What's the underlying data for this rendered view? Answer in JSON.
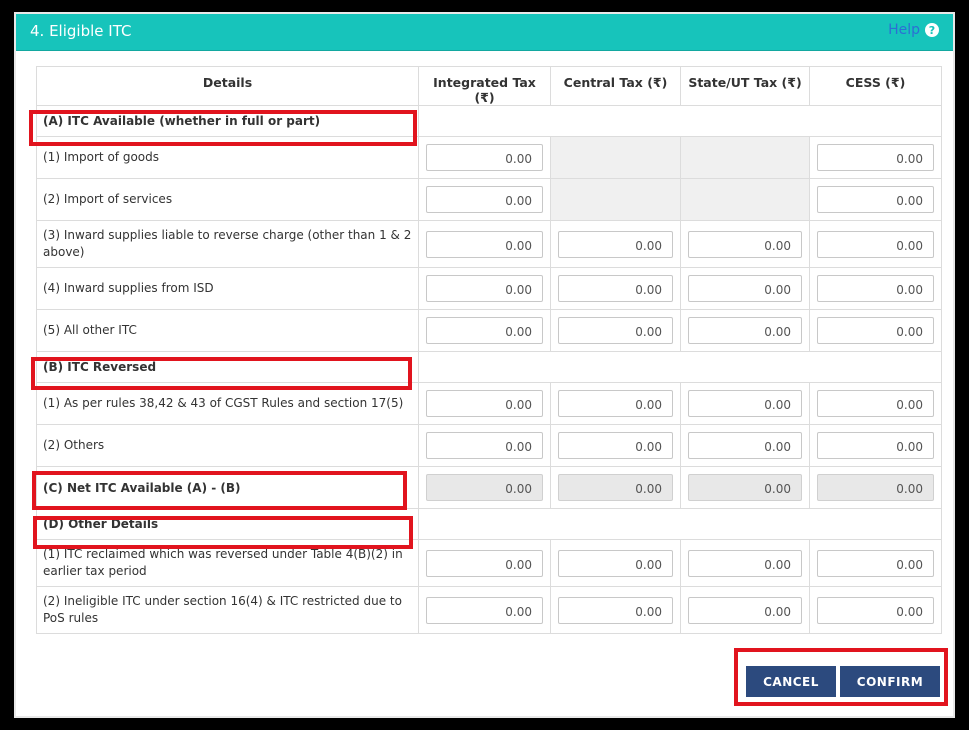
{
  "header": {
    "title": "4. Eligible ITC",
    "help_label": "Help"
  },
  "columns": [
    "Details",
    "Integrated Tax (₹)",
    "Central Tax (₹)",
    "State/UT Tax (₹)",
    "CESS (₹)"
  ],
  "sections": {
    "A": "(A) ITC Available (whether in full or part)",
    "B": "(B) ITC Reversed",
    "C": "(C) Net ITC Available (A) - (B)",
    "D": "(D) Other Details"
  },
  "rows": {
    "a1": {
      "label": "(1) Import of goods",
      "igst": "0.00",
      "cess": "0.00"
    },
    "a2": {
      "label": "(2) Import of services",
      "igst": "0.00",
      "cess": "0.00"
    },
    "a3": {
      "label": "(3) Inward supplies liable to reverse charge (other than 1 & 2 above)",
      "igst": "0.00",
      "cgst": "0.00",
      "sgst": "0.00",
      "cess": "0.00"
    },
    "a4": {
      "label": "(4) Inward supplies from ISD",
      "igst": "0.00",
      "cgst": "0.00",
      "sgst": "0.00",
      "cess": "0.00"
    },
    "a5": {
      "label": "(5) All other ITC",
      "igst": "0.00",
      "cgst": "0.00",
      "sgst": "0.00",
      "cess": "0.00"
    },
    "b1": {
      "label": "(1) As per rules 38,42 & 43 of CGST Rules and section 17(5)",
      "igst": "0.00",
      "cgst": "0.00",
      "sgst": "0.00",
      "cess": "0.00"
    },
    "b2": {
      "label": "(2) Others",
      "igst": "0.00",
      "cgst": "0.00",
      "sgst": "0.00",
      "cess": "0.00"
    },
    "c": {
      "igst": "0.00",
      "cgst": "0.00",
      "sgst": "0.00",
      "cess": "0.00"
    },
    "d1": {
      "label": "(1) ITC reclaimed which was reversed under Table 4(B)(2) in earlier tax period",
      "igst": "0.00",
      "cgst": "0.00",
      "sgst": "0.00",
      "cess": "0.00"
    },
    "d2": {
      "label": "(2) Ineligible ITC under section 16(4) & ITC restricted due to PoS rules",
      "igst": "0.00",
      "cgst": "0.00",
      "sgst": "0.00",
      "cess": "0.00"
    }
  },
  "buttons": {
    "cancel": "CANCEL",
    "confirm": "CONFIRM"
  },
  "colors": {
    "header": "#17c4bb",
    "highlight": "#e1141e",
    "button": "#2c4a7e"
  }
}
